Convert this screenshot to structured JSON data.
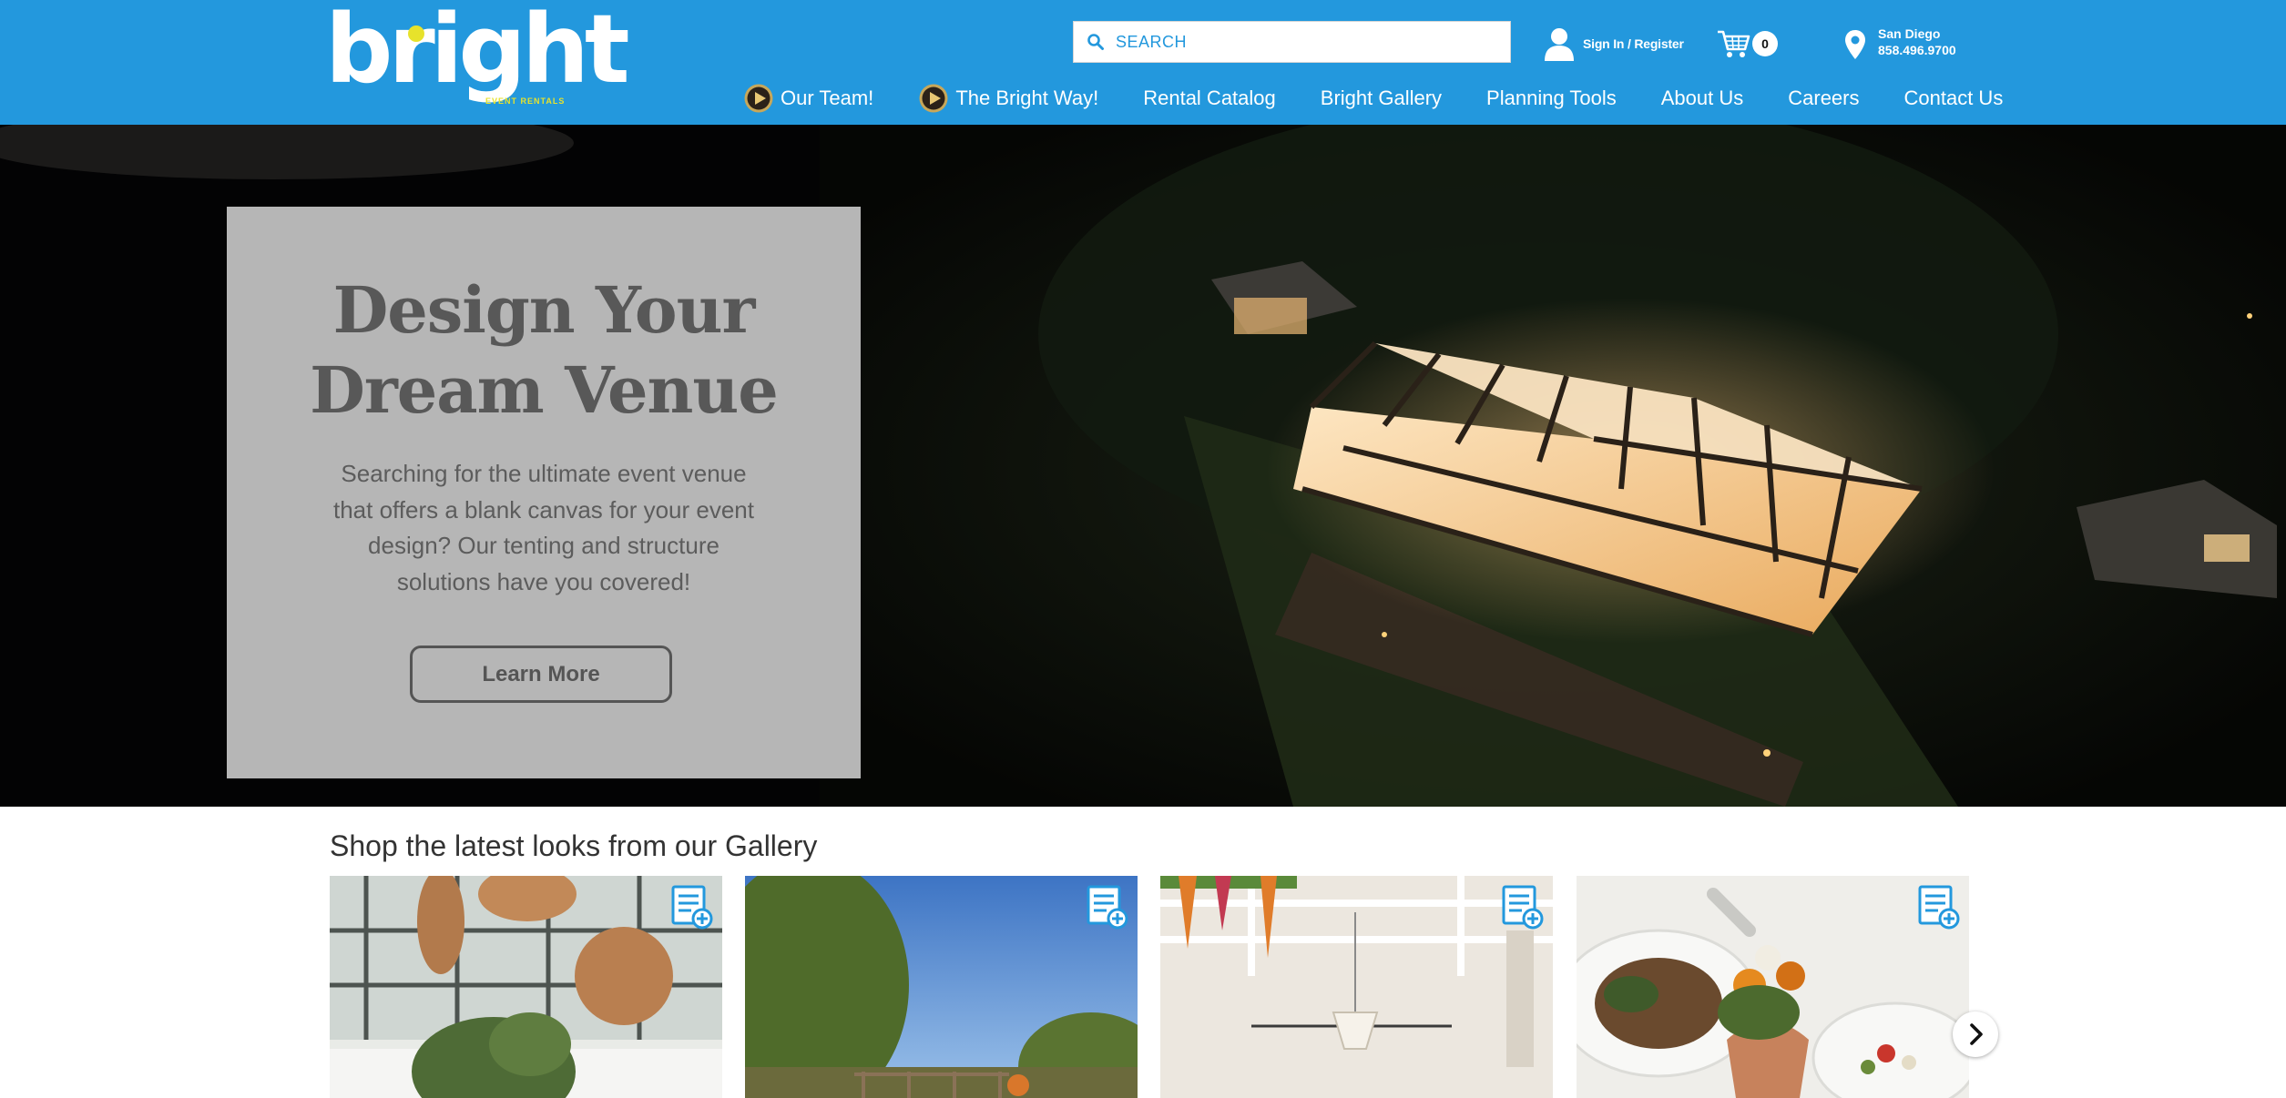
{
  "brand": {
    "logo_text": "bright",
    "logo_sub": "EVENT RENTALS",
    "colors": {
      "header_blue": "#2398dd",
      "logo_yellow": "#e7e22b",
      "card_grey": "#c4c4c4",
      "text_grey": "#585858"
    }
  },
  "header": {
    "search": {
      "placeholder": "SEARCH",
      "icon": "search-icon"
    },
    "signin_label": "Sign In / Register",
    "cart": {
      "count": "0",
      "icon": "cart-icon"
    },
    "location": {
      "city": "San Diego",
      "phone": "858.496.9700",
      "icon": "location-pin-icon"
    }
  },
  "nav": {
    "items": [
      {
        "label": "Our Team!",
        "icon": "play-icon"
      },
      {
        "label": "The Bright Way!",
        "icon": "play-icon"
      },
      {
        "label": "Rental Catalog"
      },
      {
        "label": "Bright Gallery"
      },
      {
        "label": "Planning Tools"
      },
      {
        "label": "About Us"
      },
      {
        "label": "Careers"
      },
      {
        "label": "Contact Us"
      }
    ]
  },
  "hero": {
    "title_line1": "Design Your",
    "title_line2": "Dream Venue",
    "text_line1": "Searching for the ultimate event venue",
    "text_line2": "that offers a blank canvas for your event",
    "text_line3": "design? Our tenting and structure",
    "text_line4": "solutions have you covered!",
    "button_label": "Learn More"
  },
  "gallery": {
    "title": "Shop the latest looks from our Gallery",
    "card_icon": "add-to-list-icon",
    "next_icon": "chevron-right-icon"
  }
}
